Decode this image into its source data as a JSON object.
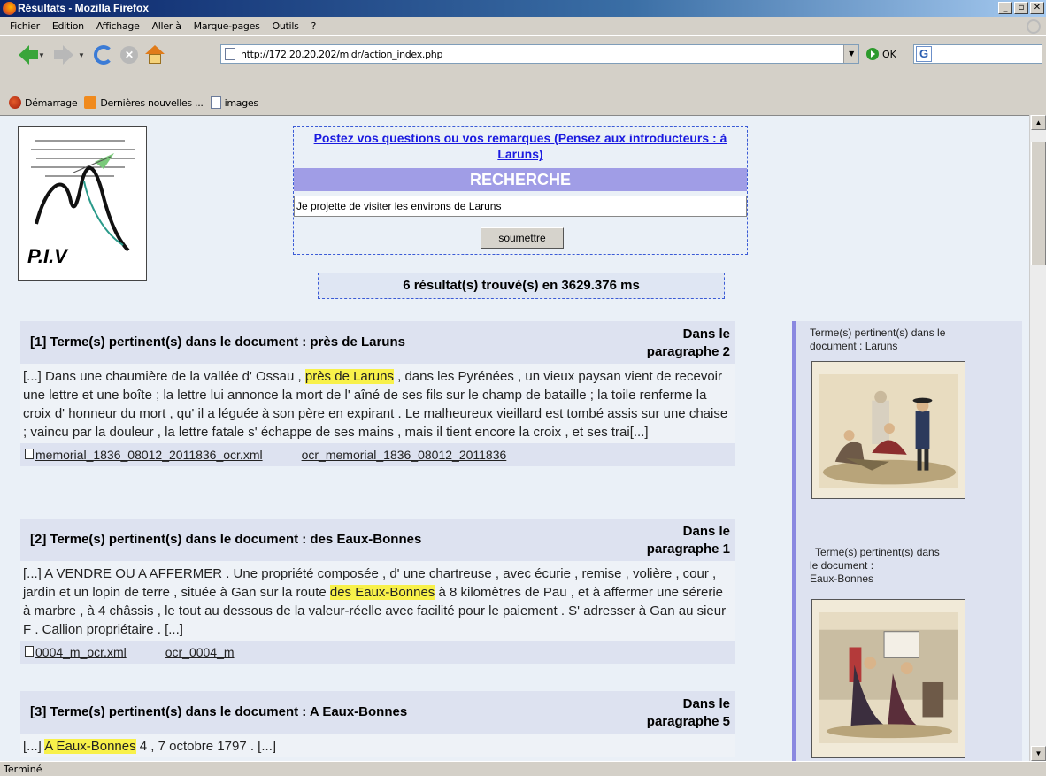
{
  "window": {
    "title": "Résultats - Mozilla Firefox",
    "controls": [
      "_",
      "▫",
      "✕"
    ]
  },
  "menu": [
    "Fichier",
    "Edition",
    "Affichage",
    "Aller à",
    "Marque-pages",
    "Outils",
    "?"
  ],
  "toolbar": {
    "url": "http://172.20.20.202/midr/action_index.php",
    "go_label": "OK"
  },
  "bookmarks": [
    "Démarrage",
    "Dernières nouvelles ...",
    "images"
  ],
  "logo_text": "P.I.V",
  "search": {
    "ask_link": "Postez vos questions ou vos remarques (Pensez aux introducteurs : à Laruns)",
    "heading": "RECHERCHE",
    "query": "Je projette de visiter les environs de Laruns",
    "submit": "soumettre"
  },
  "result_count": "6 résultat(s) trouvé(s) en 3629.376 ms",
  "results": [
    {
      "title": "[1] Terme(s) pertinent(s) dans le document : près de Laruns",
      "para_line1": "Dans le",
      "para_line2": "paragraphe 2",
      "pre": "[...] Dans une chaumière de la vallée d' Ossau , ",
      "hl": "près de Laruns",
      "post": " , dans les Pyrénées , un vieux paysan vient de recevoir une lettre et une boîte ; la lettre lui annonce la mort de l' aîné de ses fils sur le champ de bataille ; la toile renferme la croix d' honneur du mort , qu' il a léguée à son père en expirant . Le malheureux vieillard est tombé assis sur une chaise ; vaincu par la douleur , la lettre fatale s' échappe de ses mains , mais il tient encore la croix , et ses trai[...]",
      "file1": "memorial_1836_08012_2011836_ocr.xml",
      "file2": "ocr_memorial_1836_08012_2011836"
    },
    {
      "title": "[2] Terme(s) pertinent(s) dans le document : des Eaux-Bonnes",
      "para_line1": "Dans le",
      "para_line2": "paragraphe 1",
      "pre": "[...] A VENDRE OU A AFFERMER . Une propriété composée , d' une chartreuse , avec écurie , remise , volière , cour , jardin et un lopin de terre , située à Gan sur la route ",
      "hl": "des Eaux-Bonnes",
      "post": " à 8 kilomètres de Pau , et à affermer une sérerie à marbre , à 4 châssis , le tout au dessous de la valeur-réelle avec facilité pour le paiement . S' adresser à Gan au sieur F . Callion propriétaire . [...]",
      "file1": "0004_m_ocr.xml",
      "file2": "ocr_0004_m"
    },
    {
      "title": "[3] Terme(s) pertinent(s) dans le document : A Eaux-Bonnes",
      "para_line1": "Dans le",
      "para_line2": "paragraphe 5",
      "pre": "[...] ",
      "hl": "A Eaux-Bonnes",
      "post": " 4 , 7 octobre 1797 . [...]",
      "file1": "",
      "file2": ""
    }
  ],
  "side": {
    "label1": "Terme(s) pertinent(s) dans le document : Laruns",
    "label2_line1": "Terme(s) pertinent(s) dans",
    "label2_line2": "le document :",
    "label2_line3": "Eaux-Bonnes"
  },
  "status": "Terminé"
}
